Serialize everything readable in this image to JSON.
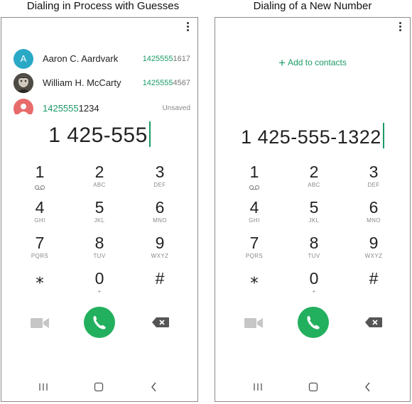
{
  "captions": {
    "left": "Dialing in Process with Guesses",
    "right": "Dialing of a New Number"
  },
  "left_screen": {
    "suggestions": [
      {
        "avatar_letter": "A",
        "name": "Aaron C. Aardvark",
        "num_match": "1425555",
        "num_rest": "1617"
      },
      {
        "avatar_letter": "",
        "name": "William H. McCarty",
        "num_match": "1425555",
        "num_rest": "4567"
      }
    ],
    "unsaved": {
      "num_match": "1425555",
      "num_rest": "1234",
      "status": "Unsaved"
    },
    "dialed_number": "1 425-555"
  },
  "right_screen": {
    "add_to_contacts": "Add to contacts",
    "dialed_number": "1 425-555-1322"
  },
  "keypad": [
    {
      "digit": "1",
      "sub": ""
    },
    {
      "digit": "2",
      "sub": "ABC"
    },
    {
      "digit": "3",
      "sub": "DEF"
    },
    {
      "digit": "4",
      "sub": "GHI"
    },
    {
      "digit": "5",
      "sub": "JKL"
    },
    {
      "digit": "6",
      "sub": "MNO"
    },
    {
      "digit": "7",
      "sub": "PQRS"
    },
    {
      "digit": "8",
      "sub": "TUV"
    },
    {
      "digit": "9",
      "sub": "WXYZ"
    },
    {
      "digit": "⁎",
      "sub": ""
    },
    {
      "digit": "0",
      "sub": "+"
    },
    {
      "digit": "#",
      "sub": ""
    }
  ],
  "colors": {
    "accent": "#1a9a66",
    "call": "#23b05e",
    "avatar_a": "#2aa9c6",
    "avatar_unknown": "#e86b6b"
  },
  "icons": [
    "more-options-icon",
    "voicemail-icon",
    "video-call-icon",
    "phone-icon",
    "backspace-icon",
    "recent-apps-icon",
    "home-icon",
    "back-icon"
  ]
}
